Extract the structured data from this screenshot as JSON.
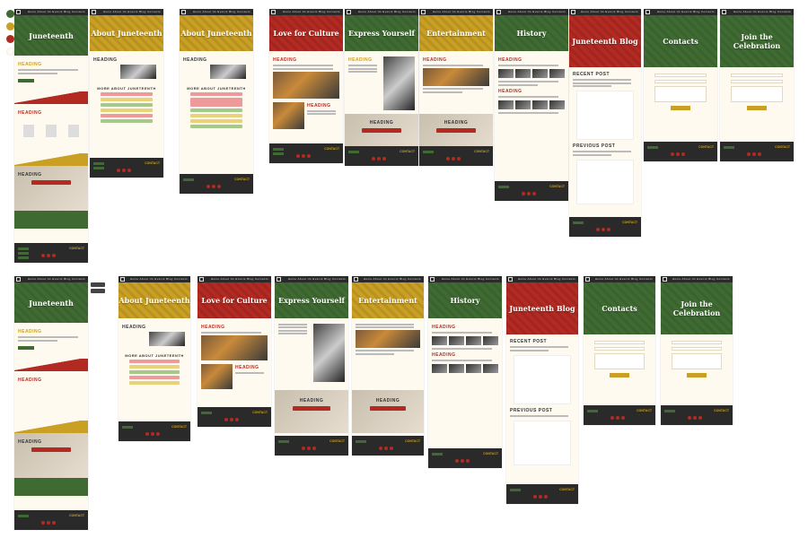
{
  "palette": {
    "green": "#3f6b32",
    "yellow": "#c9a023",
    "red": "#b22a22",
    "cream": "#fffaf0"
  },
  "nav": {
    "links": "Home   About Us   Events   Blog   Contacts"
  },
  "titles": {
    "home": "Juneteenth",
    "about": "About Juneteenth",
    "culture": "Love for Culture",
    "express": "Express Yourself",
    "entertain": "Entertainment",
    "history": "History",
    "blog": "Juneteenth Blog",
    "contacts": "Contacts",
    "join": "Join the Celebration"
  },
  "headings": {
    "heading": "HEADING",
    "more_about": "MORE ABOUT JUNETEENTH",
    "recent": "RECENT POST",
    "previous": "PREVIOUS POST"
  },
  "footer": {
    "contact": "CONTACT"
  }
}
